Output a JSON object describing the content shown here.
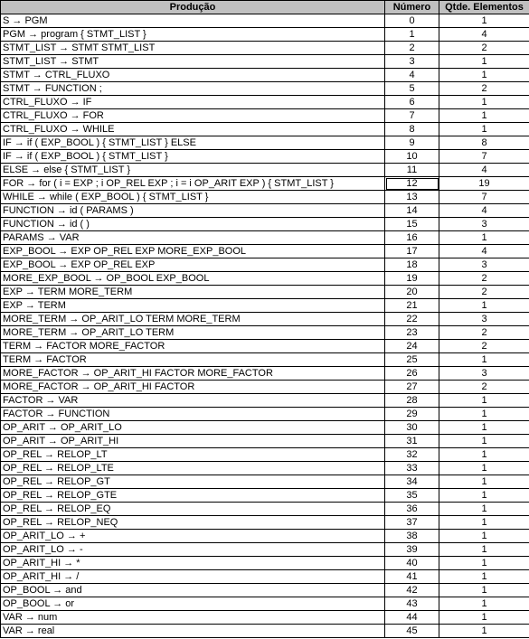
{
  "headers": [
    "Produção",
    "Número",
    "Qtde. Elementos"
  ],
  "rows": [
    {
      "prod": "S → PGM",
      "num": "0",
      "count": "1"
    },
    {
      "prod": "PGM → program { STMT_LIST }",
      "num": "1",
      "count": "4"
    },
    {
      "prod": "STMT_LIST → STMT STMT_LIST",
      "num": "2",
      "count": "2"
    },
    {
      "prod": "STMT_LIST → STMT",
      "num": "3",
      "count": "1"
    },
    {
      "prod": "STMT → CTRL_FLUXO",
      "num": "4",
      "count": "1"
    },
    {
      "prod": "STMT → FUNCTION ;",
      "num": "5",
      "count": "2"
    },
    {
      "prod": "CTRL_FLUXO → IF",
      "num": "6",
      "count": "1"
    },
    {
      "prod": "CTRL_FLUXO → FOR",
      "num": "7",
      "count": "1"
    },
    {
      "prod": "CTRL_FLUXO → WHILE",
      "num": "8",
      "count": "1"
    },
    {
      "prod": "IF → if ( EXP_BOOL ) { STMT_LIST } ELSE",
      "num": "9",
      "count": "8"
    },
    {
      "prod": "IF → if ( EXP_BOOL ) { STMT_LIST }",
      "num": "10",
      "count": "7"
    },
    {
      "prod": "ELSE → else { STMT_LIST }",
      "num": "11",
      "count": "4"
    },
    {
      "prod": "FOR → for ( i = EXP ; i OP_REL EXP ; i = i OP_ARIT EXP ) { STMT_LIST }",
      "num": "12",
      "count": "19"
    },
    {
      "prod": "WHILE → while ( EXP_BOOL ) { STMT_LIST }",
      "num": "13",
      "count": "7"
    },
    {
      "prod": "FUNCTION → id ( PARAMS )",
      "num": "14",
      "count": "4"
    },
    {
      "prod": "FUNCTION → id ( )",
      "num": "15",
      "count": "3"
    },
    {
      "prod": "PARAMS → VAR",
      "num": "16",
      "count": "1"
    },
    {
      "prod": "EXP_BOOL → EXP OP_REL EXP MORE_EXP_BOOL",
      "num": "17",
      "count": "4"
    },
    {
      "prod": "EXP_BOOL → EXP OP_REL EXP",
      "num": "18",
      "count": "3"
    },
    {
      "prod": "MORE_EXP_BOOL → OP_BOOL EXP_BOOL",
      "num": "19",
      "count": "2"
    },
    {
      "prod": "EXP → TERM MORE_TERM",
      "num": "20",
      "count": "2"
    },
    {
      "prod": "EXP → TERM",
      "num": "21",
      "count": "1"
    },
    {
      "prod": "MORE_TERM → OP_ARIT_LO TERM  MORE_TERM",
      "num": "22",
      "count": "3"
    },
    {
      "prod": "MORE_TERM → OP_ARIT_LO TERM",
      "num": "23",
      "count": "2"
    },
    {
      "prod": "TERM → FACTOR MORE_FACTOR",
      "num": "24",
      "count": "2"
    },
    {
      "prod": "TERM → FACTOR",
      "num": "25",
      "count": "1"
    },
    {
      "prod": "MORE_FACTOR → OP_ARIT_HI FACTOR MORE_FACTOR",
      "num": "26",
      "count": "3"
    },
    {
      "prod": "MORE_FACTOR → OP_ARIT_HI FACTOR",
      "num": "27",
      "count": "2"
    },
    {
      "prod": "FACTOR → VAR",
      "num": "28",
      "count": "1"
    },
    {
      "prod": "FACTOR → FUNCTION",
      "num": "29",
      "count": "1"
    },
    {
      "prod": "OP_ARIT → OP_ARIT_LO",
      "num": "30",
      "count": "1"
    },
    {
      "prod": "OP_ARIT → OP_ARIT_HI",
      "num": "31",
      "count": "1"
    },
    {
      "prod": "OP_REL → RELOP_LT",
      "num": "32",
      "count": "1"
    },
    {
      "prod": "OP_REL → RELOP_LTE",
      "num": "33",
      "count": "1"
    },
    {
      "prod": "OP_REL → RELOP_GT",
      "num": "34",
      "count": "1"
    },
    {
      "prod": "OP_REL → RELOP_GTE",
      "num": "35",
      "count": "1"
    },
    {
      "prod": "OP_REL → RELOP_EQ",
      "num": "36",
      "count": "1"
    },
    {
      "prod": "OP_REL → RELOP_NEQ",
      "num": "37",
      "count": "1"
    },
    {
      "prod": "OP_ARIT_LO → +",
      "num": "38",
      "count": "1"
    },
    {
      "prod": "OP_ARIT_LO → -",
      "num": "39",
      "count": "1"
    },
    {
      "prod": "OP_ARIT_HI → *",
      "num": "40",
      "count": "1"
    },
    {
      "prod": "OP_ARIT_HI → /",
      "num": "41",
      "count": "1"
    },
    {
      "prod": "OP_BOOL → and",
      "num": "42",
      "count": "1"
    },
    {
      "prod": "OP_BOOL → or",
      "num": "43",
      "count": "1"
    },
    {
      "prod": "VAR → num",
      "num": "44",
      "count": "1"
    },
    {
      "prod": "VAR → real",
      "num": "45",
      "count": "1"
    }
  ],
  "selected_row_index": 12,
  "colors": {
    "header_bg": "#c0c0c0",
    "border": "#000000"
  }
}
